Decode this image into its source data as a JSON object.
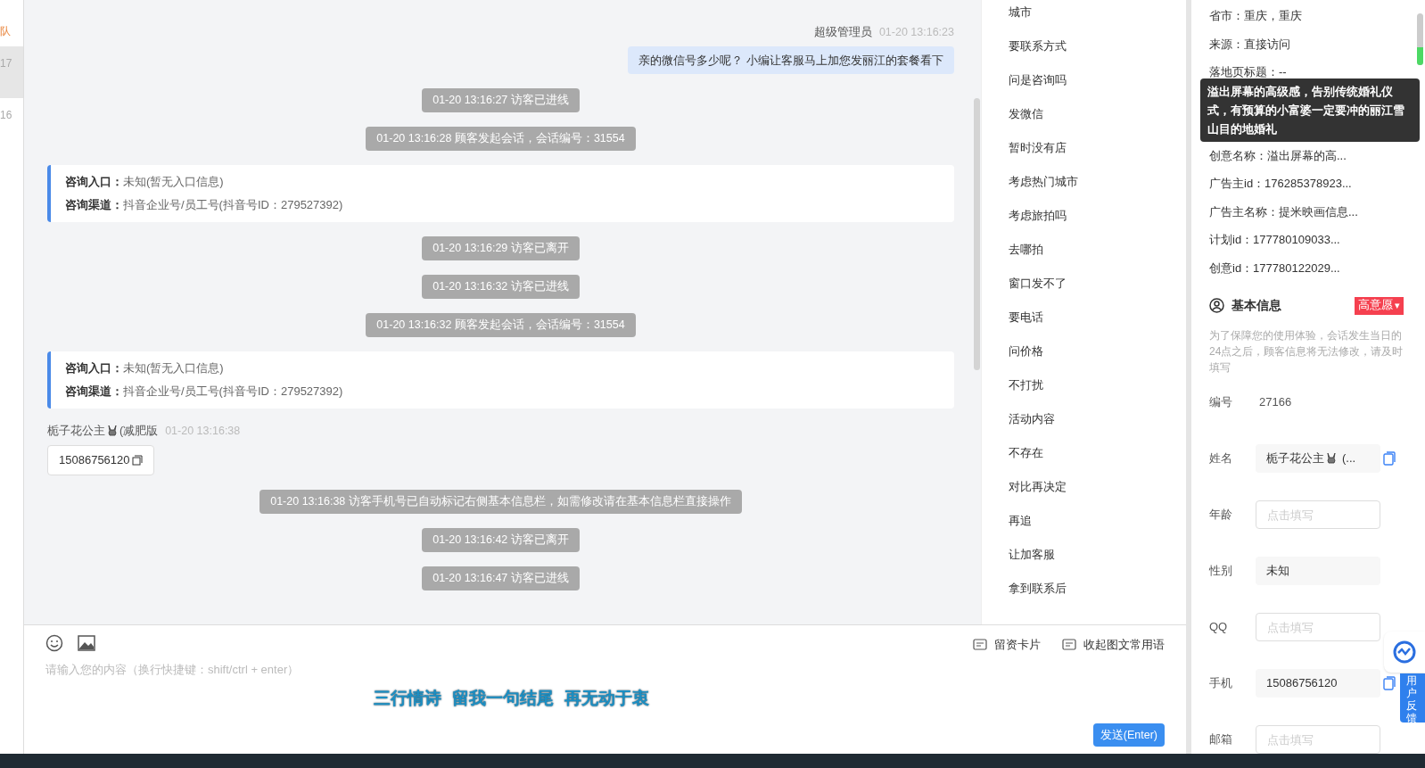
{
  "sidebar": {
    "tab_label": "队",
    "items": [
      {
        "text": "17",
        "selected": true
      },
      {
        "text": "16",
        "selected": false
      }
    ]
  },
  "chat": {
    "messages": [
      {
        "kind": "agent",
        "name": "超级管理员",
        "time": "01-20 13:16:23",
        "text": "亲的微信号多少呢？ 小编让客服马上加您发丽江的套餐看下"
      },
      {
        "kind": "system",
        "text": "01-20 13:16:27 访客已进线"
      },
      {
        "kind": "system",
        "text": "01-20 13:16:28 顾客发起会话，会话编号：31554"
      },
      {
        "kind": "info",
        "lines": [
          {
            "label": "咨询入口：",
            "value": "未知(暂无入口信息)"
          },
          {
            "label": "咨询渠道：",
            "value": "抖音企业号/员工号(抖音号ID：279527392)"
          }
        ]
      },
      {
        "kind": "system",
        "text": "01-20 13:16:29 访客已离开"
      },
      {
        "kind": "system",
        "text": "01-20 13:16:32 访客已进线"
      },
      {
        "kind": "system",
        "text": "01-20 13:16:32 顾客发起会话，会话编号：31554"
      },
      {
        "kind": "info",
        "lines": [
          {
            "label": "咨询入口：",
            "value": "未知(暂无入口信息)"
          },
          {
            "label": "咨询渠道：",
            "value": "抖音企业号/员工号(抖音号ID：279527392)"
          }
        ]
      },
      {
        "kind": "visitor",
        "name": "栀子花公主",
        "name_suffix": "(减肥版",
        "time": "01-20 13:16:38",
        "text": "15086756120"
      },
      {
        "kind": "system",
        "text": "01-20 13:16:38 访客手机号已自动标记右侧基本信息栏，如需修改请在基本信息栏直接操作"
      },
      {
        "kind": "system",
        "text": "01-20 13:16:42 访客已离开"
      },
      {
        "kind": "system",
        "text": "01-20 13:16:47 访客已进线"
      }
    ]
  },
  "quick_phrases": [
    "城市",
    "要联系方式",
    "问是咨询吗",
    "发微信",
    "暂时没有店",
    "考虑热门城市",
    "考虑旅拍吗",
    "去哪拍",
    "窗口发不了",
    "要电话",
    "问价格",
    "不打扰",
    "活动内容",
    "不存在",
    "对比再决定",
    "再追",
    "让加客服",
    "拿到联系后"
  ],
  "composer": {
    "placeholder": "请输入您的内容（换行快捷键：shift/ctrl + enter）",
    "tools": [
      "留资卡片",
      "收起图文常用语"
    ],
    "send_button": "发送(Enter)"
  },
  "lyrics_overlay": [
    "三行情诗",
    "留我一句结尾",
    "再无动于衷"
  ],
  "visitor_panel": {
    "source_rows_top": [
      "省市：重庆，重庆",
      "来源：直接访问",
      "落地页标题：--"
    ],
    "source_rows": [
      "创意名称：溢出屏幕的高...",
      "广告主id：176285378923...",
      "广告主名称：提米映画信息...",
      "计划id：177780109033...",
      "创意id：177780122029..."
    ],
    "tooltip": "溢出屏幕的高级感，告别传统婚礼仪式，有预算的小富婆一定要冲的丽江雪山目的地婚礼",
    "basic_info": {
      "title": "基本信息",
      "intent_badge": "高意愿",
      "intent_caret": "▾",
      "note": "为了保障您的使用体验，会话发生当日的24点之后，顾客信息将无法修改，请及时填写",
      "fields": [
        {
          "kind": "text",
          "label": "编号",
          "value": "27166",
          "copyable": false
        },
        {
          "kind": "filled",
          "label": "姓名",
          "value": "栀子花公主",
          "value_suffix": "(...",
          "rabbit": true,
          "copyable": true
        },
        {
          "kind": "input",
          "label": "年龄",
          "placeholder": "点击填写",
          "copyable": false
        },
        {
          "kind": "filled",
          "label": "性别",
          "value": "未知",
          "rabbit": false,
          "copyable": false
        },
        {
          "kind": "input",
          "label": "QQ",
          "placeholder": "点击填写",
          "copyable": false
        },
        {
          "kind": "filled",
          "label": "手机",
          "value": "15086756120",
          "rabbit": false,
          "copyable": true
        },
        {
          "kind": "input",
          "label": "邮箱",
          "placeholder": "点击填写",
          "copyable": false
        }
      ]
    }
  },
  "feedback_tab": "用户反馈"
}
